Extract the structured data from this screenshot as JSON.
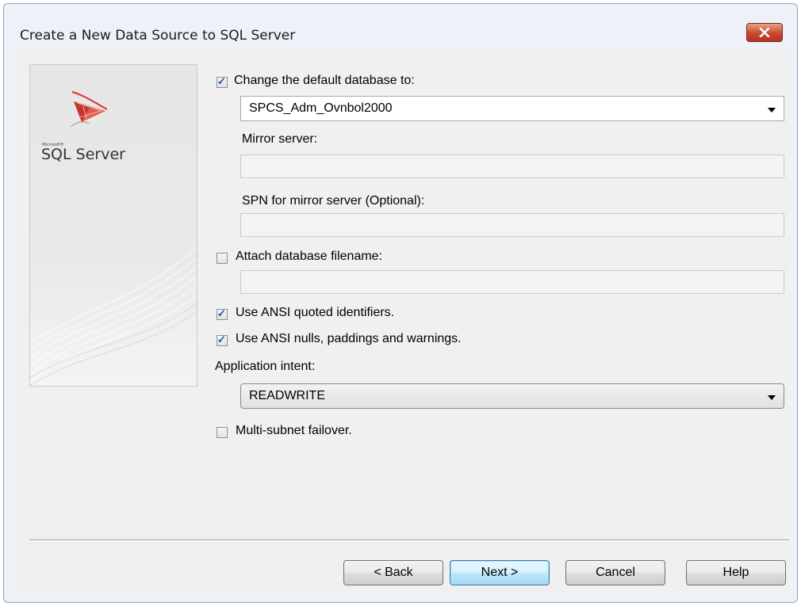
{
  "window": {
    "title": "Create a New Data Source to SQL Server"
  },
  "branding": {
    "microsoft_label": "Microsoft®",
    "product_label": "SQL Server",
    "logo_icon": "sql-server-logo-icon"
  },
  "options": {
    "change_default_db": {
      "label": "Change the default database to:",
      "checked": true
    },
    "default_db_value": "SPCS_Adm_Ovnbol2000",
    "mirror_server": {
      "label": "Mirror server:",
      "value": ""
    },
    "spn_mirror": {
      "label": "SPN for mirror server (Optional):",
      "value": ""
    },
    "attach_db": {
      "label": "Attach database filename:",
      "checked": false,
      "value": ""
    },
    "ansi_quoted": {
      "label": "Use ANSI quoted identifiers.",
      "checked": true
    },
    "ansi_nulls": {
      "label": "Use ANSI nulls, paddings and warnings.",
      "checked": true
    },
    "app_intent": {
      "label": "Application intent:",
      "value": "READWRITE"
    },
    "multisubnet": {
      "label": "Multi-subnet failover.",
      "checked": false
    }
  },
  "buttons": {
    "back": "< Back",
    "next": "Next >",
    "cancel": "Cancel",
    "help": "Help"
  },
  "colors": {
    "frame": "#eef2f8",
    "client": "#f0f0f0",
    "close_red": "#c9482f",
    "check_blue": "#1f4fa8"
  }
}
